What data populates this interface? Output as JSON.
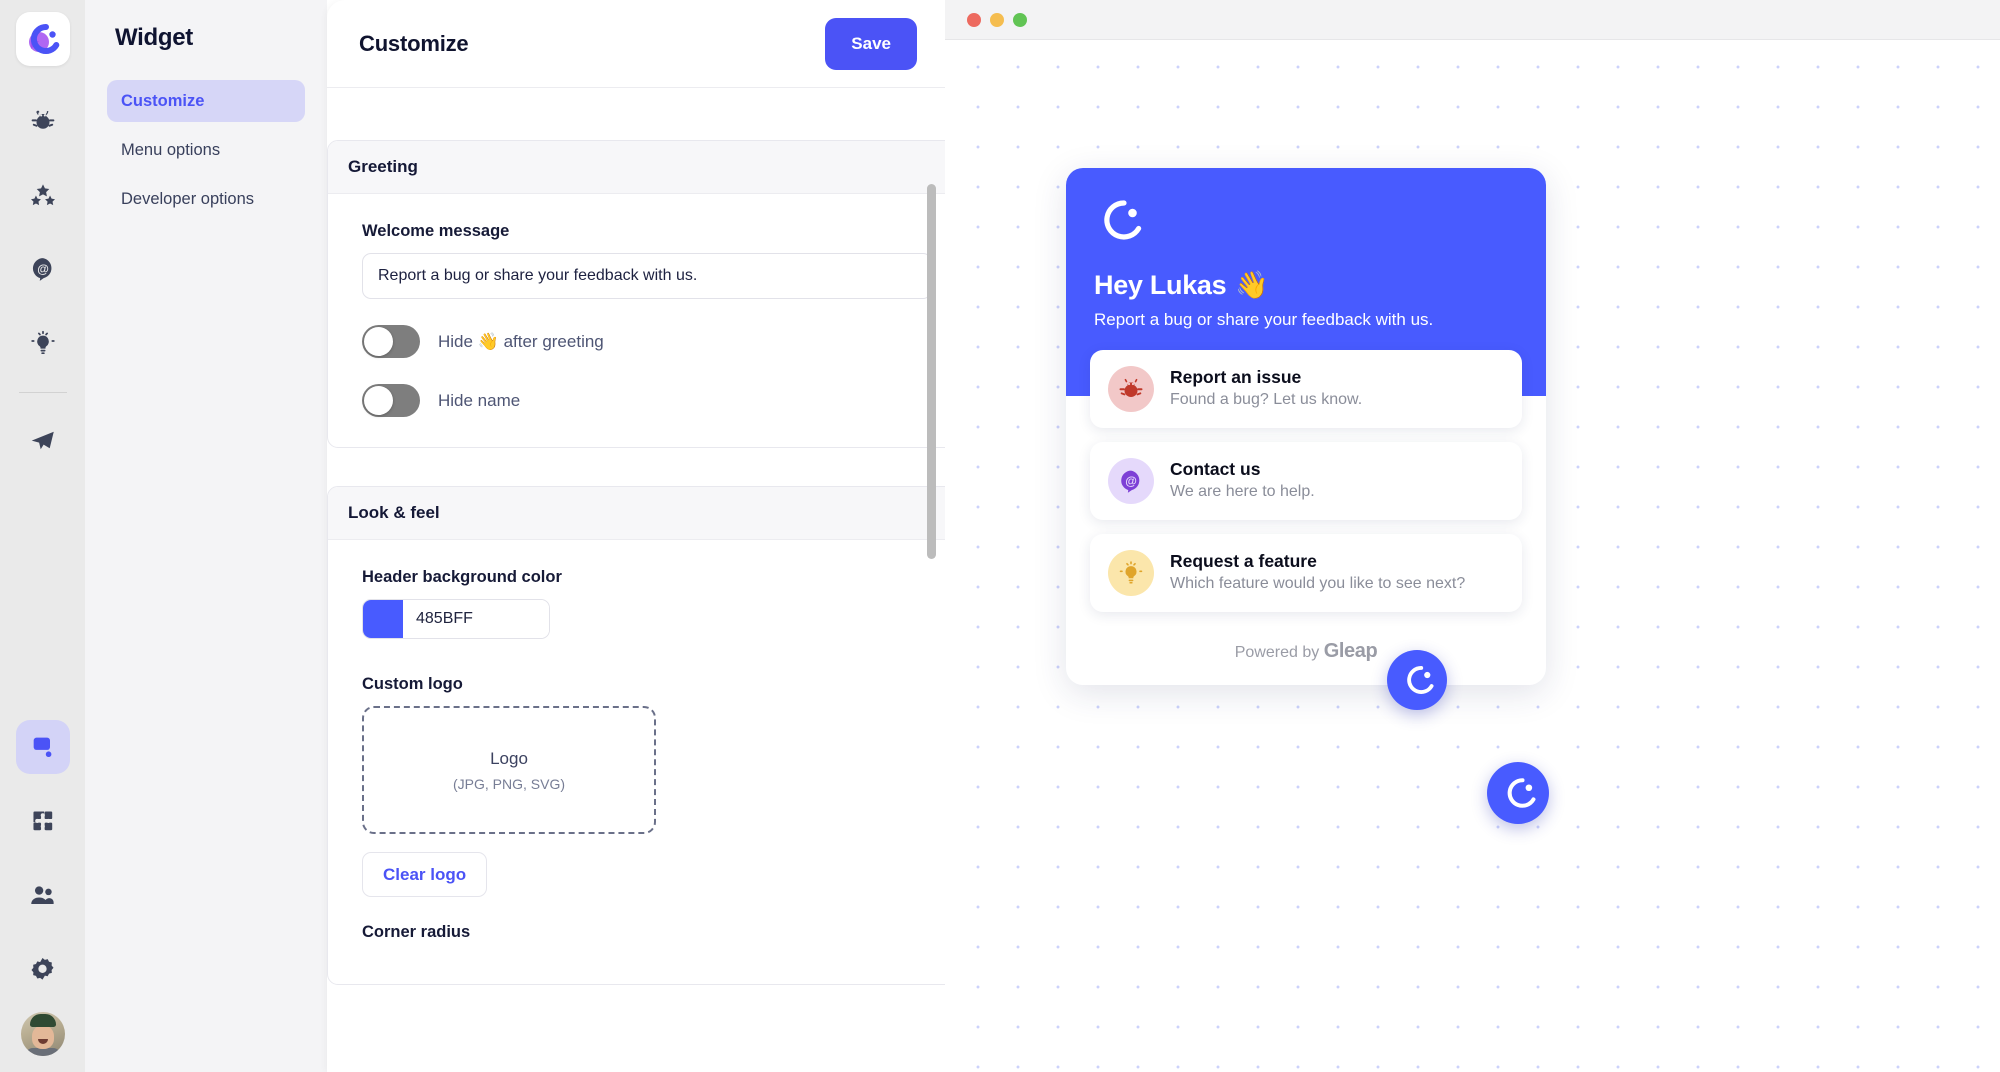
{
  "rail": {
    "logo_icon": "gleap-logo-icon",
    "items": [
      {
        "name": "bug-icon",
        "label": "Bugs"
      },
      {
        "name": "stars-icon",
        "label": "Ratings"
      },
      {
        "name": "at-mention-icon",
        "label": "Contact"
      },
      {
        "name": "lightbulb-icon",
        "label": "Feature requests"
      },
      {
        "name": "paper-plane-icon",
        "label": "Outbound"
      },
      {
        "name": "widget-screen-icon",
        "label": "Widget",
        "active": true
      },
      {
        "name": "puzzle-icon",
        "label": "Integrations"
      },
      {
        "name": "people-icon",
        "label": "Team"
      },
      {
        "name": "gear-icon",
        "label": "Settings"
      }
    ],
    "avatar": "user-avatar"
  },
  "subnav": {
    "title": "Widget",
    "items": [
      {
        "label": "Customize",
        "active": true
      },
      {
        "label": "Menu options",
        "active": false
      },
      {
        "label": "Developer options",
        "active": false
      }
    ]
  },
  "main": {
    "title": "Customize",
    "save_label": "Save",
    "greeting": {
      "card_title": "Greeting",
      "welcome_label": "Welcome message",
      "welcome_value": "Report a bug or share your feedback with us.",
      "welcome_placeholder": "Welcome message",
      "toggles": [
        {
          "label": "Hide 👋 after greeting",
          "on": false
        },
        {
          "label": "Hide name",
          "on": false
        }
      ]
    },
    "look_feel": {
      "card_title": "Look & feel",
      "header_color_label": "Header background color",
      "header_color_value": "485BFF",
      "header_color_hex": "#485BFF",
      "custom_logo_label": "Custom logo",
      "logo_drop_title": "Logo",
      "logo_drop_sub": "(JPG, PNG, SVG)",
      "clear_logo_label": "Clear logo",
      "corner_radius_label": "Corner radius"
    }
  },
  "preview": {
    "window_controls": [
      "close",
      "minimize",
      "maximize"
    ],
    "widget": {
      "header_color": "#485BFF",
      "greeting_title": "Hey Lukas",
      "greeting_emoji": "👋",
      "greeting_subtitle": "Report a bug or share your feedback with us.",
      "menu": [
        {
          "icon": "bug-icon",
          "title": "Report an issue",
          "desc": "Found a bug? Let us know."
        },
        {
          "icon": "at-mention-icon",
          "title": "Contact us",
          "desc": "We are here to help."
        },
        {
          "icon": "lightbulb-icon",
          "title": "Request a feature",
          "desc": "Which feature would you like to see next?"
        }
      ],
      "powered_prefix": "Powered by",
      "powered_brand": "Gleap"
    },
    "fabs": [
      {
        "name": "widget-launcher-small"
      },
      {
        "name": "widget-launcher-large"
      }
    ]
  }
}
